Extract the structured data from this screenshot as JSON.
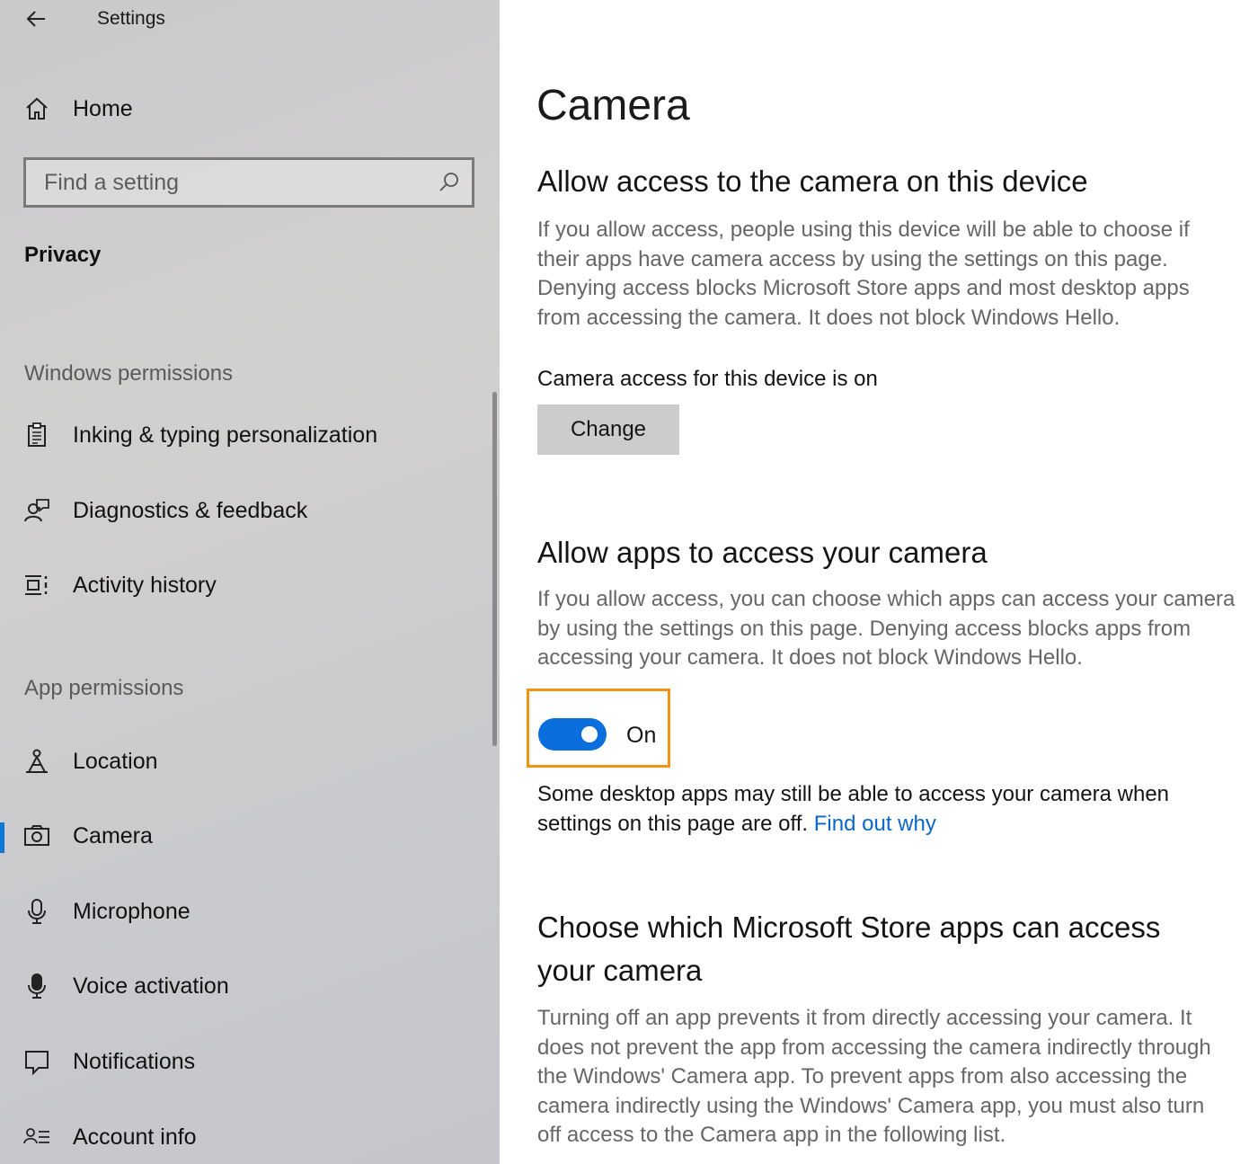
{
  "window": {
    "title": "Settings"
  },
  "sidebar": {
    "home_label": "Home",
    "search_placeholder": "Find a setting",
    "section_title": "Privacy",
    "windows_permissions": {
      "label": "Windows permissions",
      "items": [
        {
          "label": "Inking & typing personalization",
          "icon": "clipboard-icon"
        },
        {
          "label": "Diagnostics & feedback",
          "icon": "person-feedback-icon"
        },
        {
          "label": "Activity history",
          "icon": "activity-history-icon"
        }
      ]
    },
    "app_permissions": {
      "label": "App permissions",
      "items": [
        {
          "label": "Location",
          "icon": "location-icon"
        },
        {
          "label": "Camera",
          "icon": "camera-icon",
          "selected": true
        },
        {
          "label": "Microphone",
          "icon": "microphone-icon"
        },
        {
          "label": "Voice activation",
          "icon": "voice-activation-icon"
        },
        {
          "label": "Notifications",
          "icon": "notifications-icon"
        },
        {
          "label": "Account info",
          "icon": "account-info-icon"
        }
      ]
    }
  },
  "main": {
    "title": "Camera",
    "device_section": {
      "heading": "Allow access to the camera on this device",
      "description_lines": [
        "If you allow access, people using this device will be able to choose if",
        "their apps have camera access by using the settings on this page.",
        "Denying access blocks Microsoft Store apps and most desktop apps",
        "from accessing the camera. It does not block Windows Hello."
      ],
      "status": "Camera access for this device is on",
      "button_label": "Change"
    },
    "apps_section": {
      "heading": "Allow apps to access your camera",
      "description_lines": [
        "If you allow access, you can choose which apps can access your camera",
        "by using the settings on this page. Denying access blocks apps from",
        "accessing your camera. It does not block Windows Hello."
      ],
      "toggle_state": "On",
      "toggle_on": true,
      "note_line1": "Some desktop apps may still be able to access your camera when",
      "note_line2": "settings on this page are off.",
      "note_link": "Find out why"
    },
    "store_section": {
      "heading_line1": "Choose which Microsoft Store apps can access",
      "heading_line2": "your camera",
      "description_lines": [
        "Turning off an app prevents it from directly accessing your camera. It",
        "does not prevent the app from accessing the camera indirectly through",
        "the Windows' Camera app. To prevent apps from also accessing the",
        "camera indirectly using the Windows' Camera app, you must also turn",
        "off access to the Camera app in the following list."
      ]
    }
  },
  "colors": {
    "accent": "#0a78d7",
    "toggle_on": "#0a6fdc",
    "highlight_frame": "#f39416",
    "link": "#0a67c9"
  }
}
